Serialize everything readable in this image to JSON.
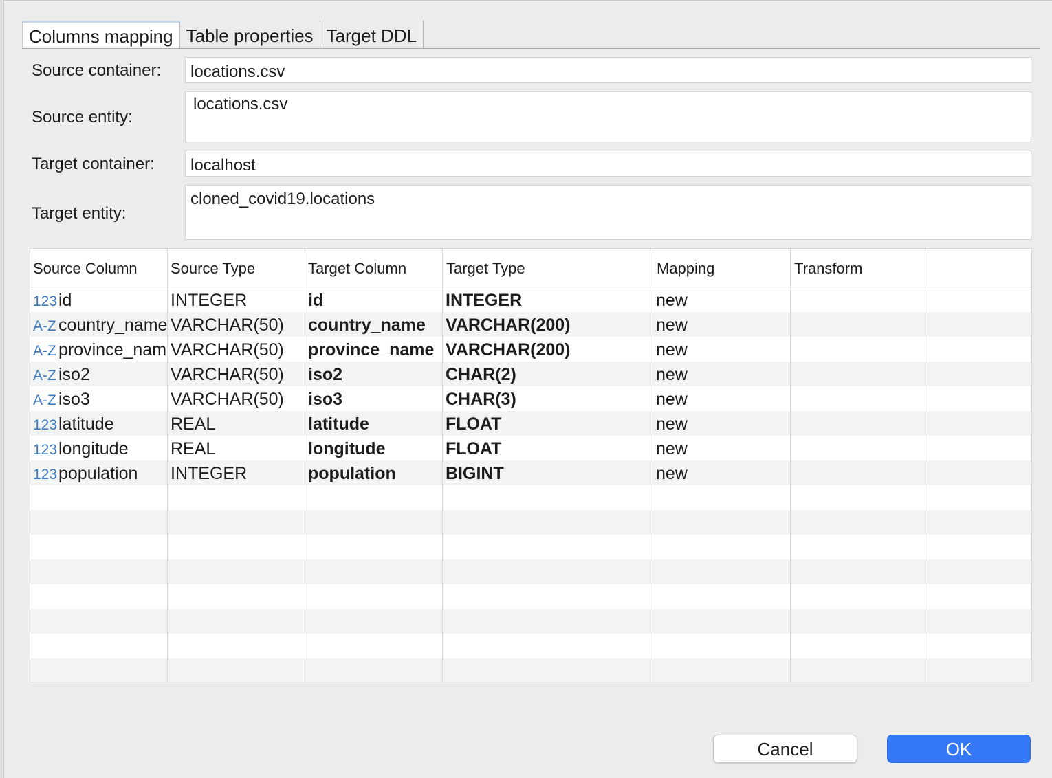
{
  "tabs": [
    {
      "label": "Columns mapping"
    },
    {
      "label": "Table properties"
    },
    {
      "label": "Target DDL"
    }
  ],
  "form": {
    "source_container": {
      "label": "Source container:",
      "value": "locations.csv"
    },
    "source_entity": {
      "label": "Source entity:",
      "value": "locations.csv"
    },
    "target_container": {
      "label": "Target container:",
      "value": "localhost"
    },
    "target_entity": {
      "label": "Target entity:",
      "value": "cloned_covid19.locations"
    }
  },
  "grid": {
    "headers": [
      "Source Column",
      "Source Type",
      "Target Column",
      "Target Type",
      "Mapping",
      "Transform"
    ],
    "rows": [
      {
        "icon": "123",
        "source_column": "id",
        "source_type": "INTEGER",
        "target_column": "id",
        "target_type": "INTEGER",
        "mapping": "new",
        "transform": ""
      },
      {
        "icon": "A-Z",
        "source_column": "country_name",
        "source_type": "VARCHAR(50)",
        "target_column": "country_name",
        "target_type": "VARCHAR(200)",
        "mapping": "new",
        "transform": ""
      },
      {
        "icon": "A-Z",
        "source_column": "province_name",
        "source_type": "VARCHAR(50)",
        "target_column": "province_name",
        "target_type": "VARCHAR(200)",
        "mapping": "new",
        "transform": ""
      },
      {
        "icon": "A-Z",
        "source_column": "iso2",
        "source_type": "VARCHAR(50)",
        "target_column": "iso2",
        "target_type": "CHAR(2)",
        "mapping": "new",
        "transform": ""
      },
      {
        "icon": "A-Z",
        "source_column": "iso3",
        "source_type": "VARCHAR(50)",
        "target_column": "iso3",
        "target_type": "CHAR(3)",
        "mapping": "new",
        "transform": ""
      },
      {
        "icon": "123",
        "source_column": "latitude",
        "source_type": "REAL",
        "target_column": "latitude",
        "target_type": "FLOAT",
        "mapping": "new",
        "transform": ""
      },
      {
        "icon": "123",
        "source_column": "longitude",
        "source_type": "REAL",
        "target_column": "longitude",
        "target_type": "FLOAT",
        "mapping": "new",
        "transform": ""
      },
      {
        "icon": "123",
        "source_column": "population",
        "source_type": "INTEGER",
        "target_column": "population",
        "target_type": "BIGINT",
        "mapping": "new",
        "transform": ""
      }
    ]
  },
  "buttons": {
    "cancel": "Cancel",
    "ok": "OK"
  },
  "colors": {
    "accent": "#3478f6",
    "type_icon": "#3a7bc1",
    "row_alt": "#f2f3f3"
  }
}
